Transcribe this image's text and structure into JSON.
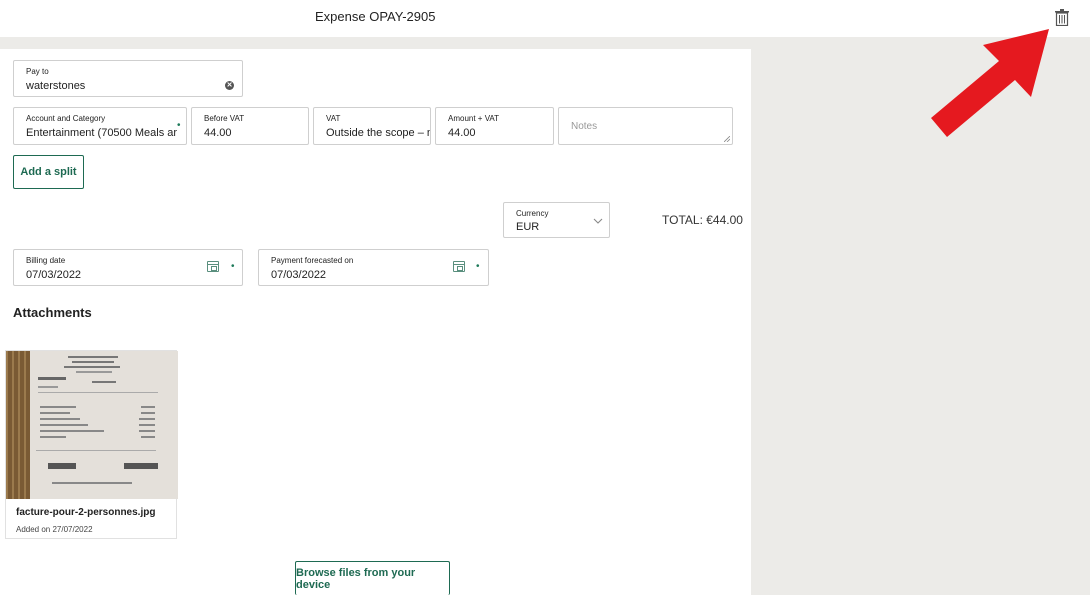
{
  "header": {
    "title": "Expense OPAY-2905",
    "delete_icon": "trash-icon"
  },
  "pay_to": {
    "label": "Pay to",
    "value": "waterstones"
  },
  "split": {
    "account": {
      "label": "Account and Category",
      "value": "Entertainment (70500 Meals ar"
    },
    "before_vat": {
      "label": "Before VAT",
      "value": "44.00"
    },
    "vat": {
      "label": "VAT",
      "value": "Outside the scope – n"
    },
    "amount_vat": {
      "label": "Amount + VAT",
      "value": "44.00"
    },
    "notes": {
      "placeholder": "Notes"
    }
  },
  "add_split_label": "Add a split",
  "currency": {
    "label": "Currency",
    "value": "EUR"
  },
  "total": "TOTAL: €44.00",
  "billing_date": {
    "label": "Billing date",
    "value": "07/03/2022"
  },
  "payment_forecast": {
    "label": "Payment forecasted on",
    "value": "07/03/2022"
  },
  "attachments": {
    "title": "Attachments",
    "items": [
      {
        "name": "facture-pour-2-personnes.jpg",
        "added": "Added on 27/07/2022"
      }
    ]
  },
  "browse_label": "Browse files from your device",
  "accent_color": "#1e6a52"
}
